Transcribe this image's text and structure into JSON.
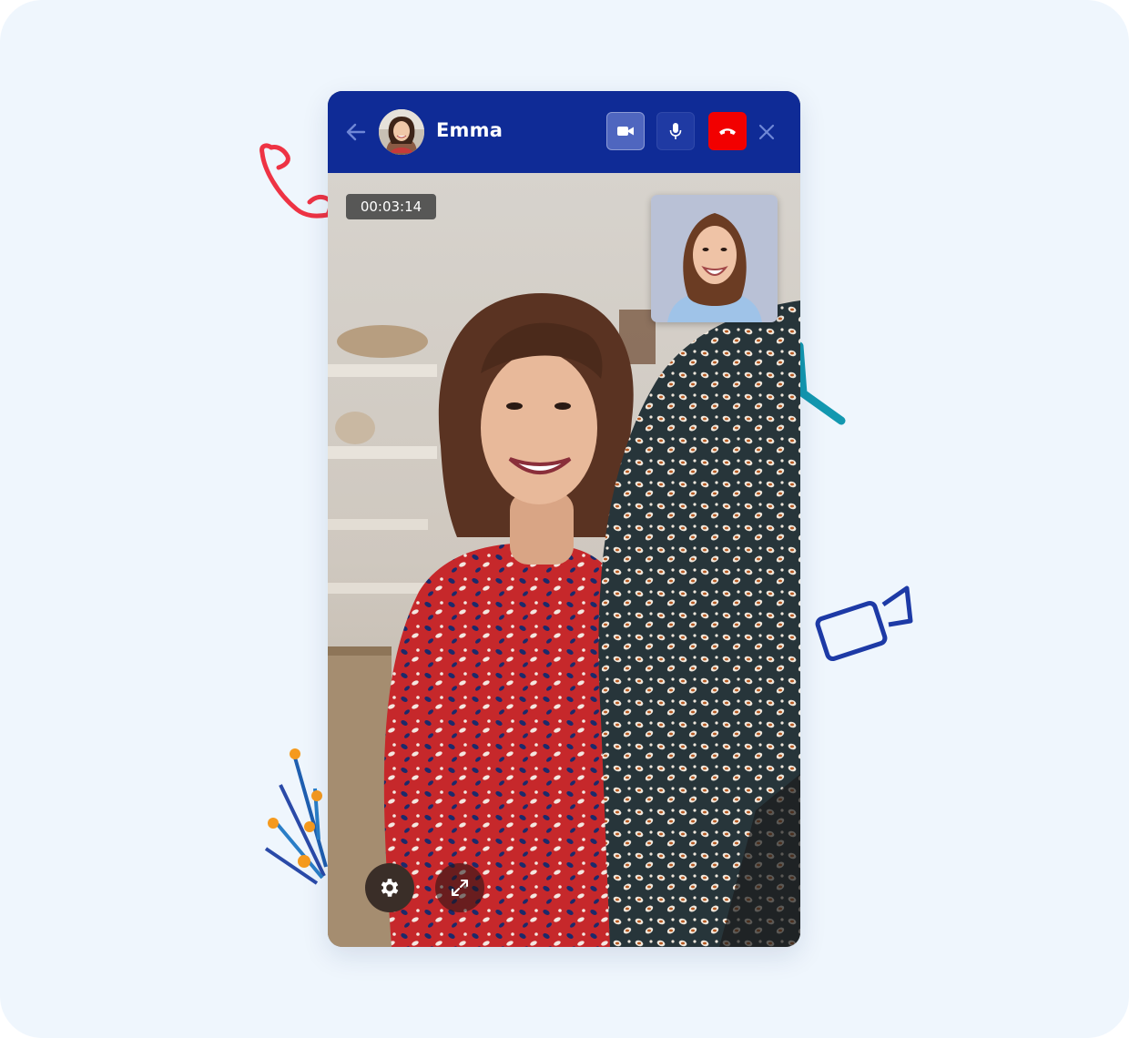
{
  "call": {
    "contact_name": "Emma",
    "duration": "00:03:14"
  },
  "icons": {
    "back": "arrow-left-icon",
    "video": "video-camera-icon",
    "mic": "microphone-icon",
    "hangup": "phone-hangup-icon",
    "close": "close-icon",
    "settings": "gear-icon",
    "fullscreen": "expand-icon"
  },
  "colors": {
    "header": "#0f2b96",
    "hangup": "#f20000",
    "page_background": "#eff6fd"
  }
}
